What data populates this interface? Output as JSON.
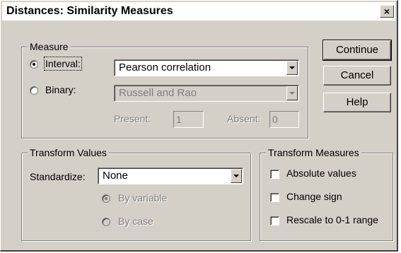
{
  "window": {
    "title": "Distances: Similarity Measures",
    "close_glyph": "×"
  },
  "measure": {
    "legend": "Measure",
    "interval": {
      "label": "Interval:",
      "checked": true,
      "selected": "Pearson correlation"
    },
    "binary": {
      "label": "Binary:",
      "checked": false,
      "selected": "Russell and Rao"
    },
    "present": {
      "label": "Present:",
      "value": "1"
    },
    "absent": {
      "label": "Absent:",
      "value": "0"
    }
  },
  "transform_values": {
    "legend": "Transform Values",
    "standardize_label": "Standardize:",
    "standardize_selected": "None",
    "by_variable": {
      "label": "By variable",
      "checked": true
    },
    "by_case": {
      "label": "By case",
      "checked": false
    }
  },
  "transform_measures": {
    "legend": "Transform Measures",
    "options": [
      {
        "label": "Absolute values",
        "checked": false
      },
      {
        "label": "Change sign",
        "checked": false
      },
      {
        "label": "Rescale to 0-1 range",
        "checked": false
      }
    ]
  },
  "buttons": {
    "continue": "Continue",
    "cancel": "Cancel",
    "help": "Help"
  }
}
